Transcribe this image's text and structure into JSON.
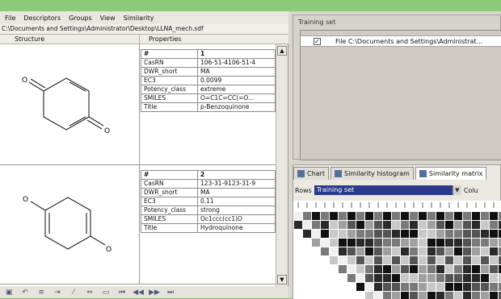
{
  "menu": [
    "File",
    "Descriptors",
    "Groups",
    "View",
    "Similarity"
  ],
  "path": "C:\\Documents and Settings\\Administrator\\Desktop\\LLNA_mech.sdf",
  "columns": {
    "structure": "Structure",
    "properties": "Properties"
  },
  "records": [
    {
      "rows": [
        [
          "#",
          "1"
        ],
        [
          "CasRN",
          "106-51-4106-51-4"
        ],
        [
          "DWR_short",
          "MA"
        ],
        [
          "EC3",
          "0.0099"
        ],
        [
          "Potency_class",
          "extreme"
        ],
        [
          "SMILES",
          "O=C1C=CC(=O..."
        ],
        [
          "Title",
          "p-Benzoquinone"
        ]
      ]
    },
    {
      "rows": [
        [
          "#",
          "2"
        ],
        [
          "CasRN",
          "123-31-9123-31-9"
        ],
        [
          "DWR_short",
          "MA"
        ],
        [
          "EC3",
          "0.11"
        ],
        [
          "Potency_class",
          "strong"
        ],
        [
          "SMILES",
          "Oc1ccc(cc1)O"
        ],
        [
          "Title",
          "Hydroquinone"
        ]
      ]
    }
  ],
  "atoms": {
    "o": "O"
  },
  "toolbar_icons": [
    "save-icon",
    "undo-icon",
    "group-icon",
    "export-icon",
    "draw-icon",
    "expand-icon",
    "collapse-icon",
    "first-icon",
    "prev-icon",
    "next-icon",
    "last-icon"
  ],
  "training": {
    "title": "Training set",
    "checked": true,
    "file": "File C:\\Documents and Settings\\Administrat..."
  },
  "tabs": [
    "Chart",
    "Similarity histogram",
    "Similarity matrix"
  ],
  "rows_label": "Rows",
  "rows_value": "Training set",
  "cols_label": "Colu"
}
